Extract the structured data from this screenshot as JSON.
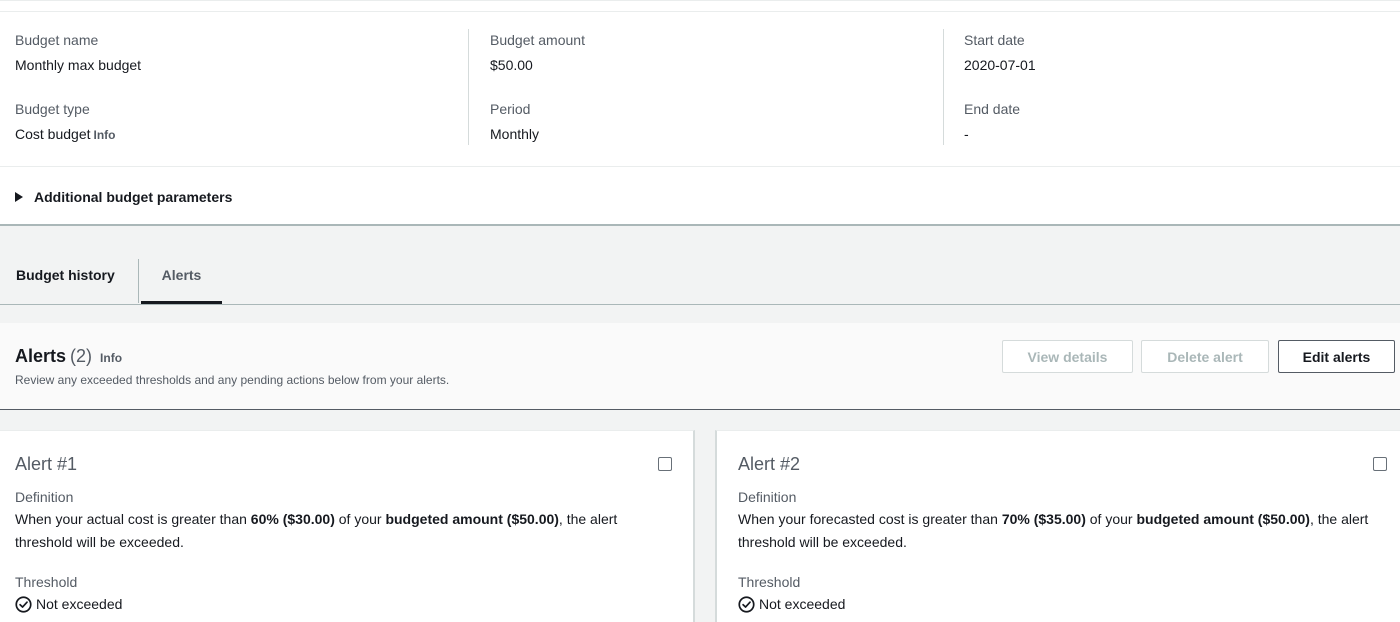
{
  "summary": {
    "budget_name_label": "Budget name",
    "budget_name_value": "Monthly max budget",
    "budget_type_label": "Budget type",
    "budget_type_value": "Cost budget",
    "budget_type_info": "Info",
    "budget_amount_label": "Budget amount",
    "budget_amount_value": "$50.00",
    "period_label": "Period",
    "period_value": "Monthly",
    "start_date_label": "Start date",
    "start_date_value": "2020-07-01",
    "end_date_label": "End date",
    "end_date_value": "-",
    "additional_params_label": "Additional budget parameters"
  },
  "tabs": [
    {
      "label": "Budget history",
      "active": false
    },
    {
      "label": "Alerts",
      "active": true
    }
  ],
  "alerts_panel": {
    "title": "Alerts",
    "count": "(2)",
    "info": "Info",
    "description": "Review any exceeded thresholds and any pending actions below from your alerts.",
    "view_details_label": "View details",
    "delete_alert_label": "Delete alert",
    "edit_alerts_label": "Edit alerts"
  },
  "alerts": [
    {
      "title": "Alert #1",
      "definition_label": "Definition",
      "definition_pre": "When your actual cost is greater than ",
      "threshold_bold": "60% ($30.00)",
      "definition_mid": " of your ",
      "amount_bold": "budgeted amount ($50.00)",
      "definition_post": ", the alert threshold will be exceeded.",
      "threshold_label": "Threshold",
      "threshold_status": "Not exceeded"
    },
    {
      "title": "Alert #2",
      "definition_label": "Definition",
      "definition_pre": "When your forecasted cost is greater than ",
      "threshold_bold": "70% ($35.00)",
      "definition_mid": " of your ",
      "amount_bold": "budgeted amount ($50.00)",
      "definition_post": ", the alert threshold will be exceeded.",
      "threshold_label": "Threshold",
      "threshold_status": "Not exceeded"
    }
  ],
  "icons": {
    "expand": "caret-right-icon",
    "status": "check-circle-icon",
    "select": "checkbox"
  },
  "colors": {
    "text_primary": "#16191f",
    "text_secondary": "#545b64",
    "disabled": "#aab7b8",
    "background": "#f2f3f3"
  }
}
